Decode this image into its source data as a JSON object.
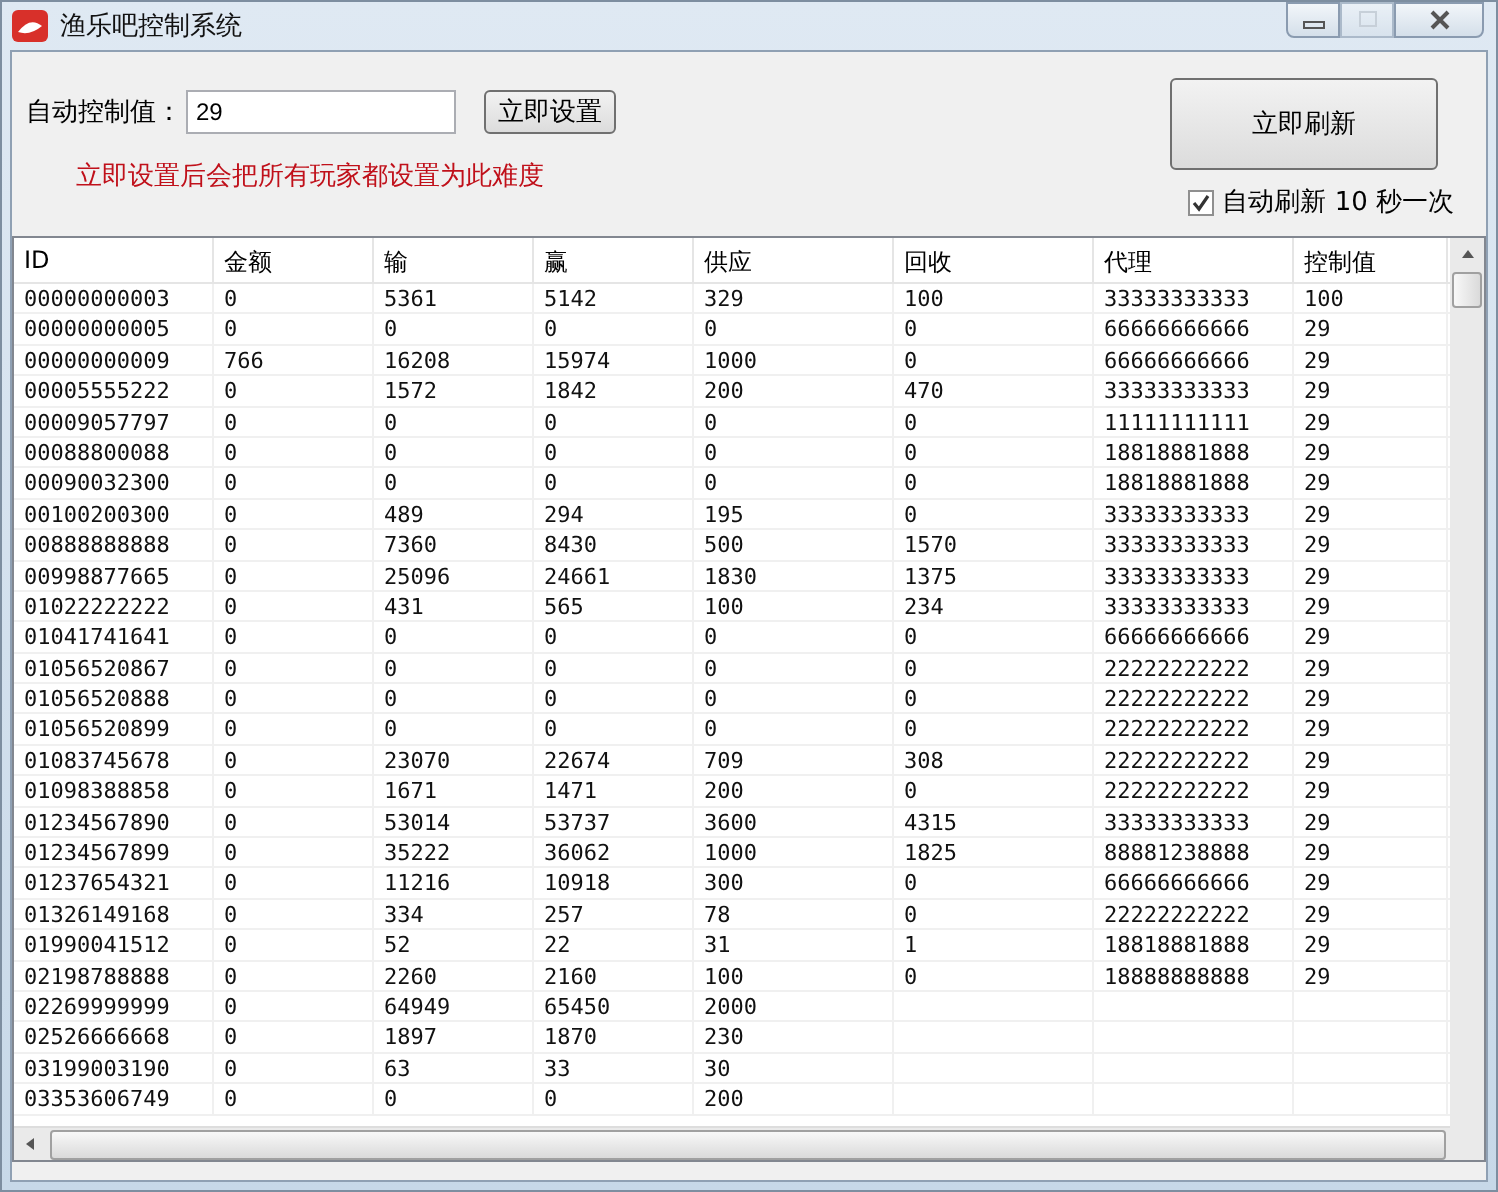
{
  "window": {
    "title": "渔乐吧控制系统",
    "buttons": [
      {
        "kind": "minimize",
        "disabled": false
      },
      {
        "kind": "maximize",
        "disabled": true
      },
      {
        "kind": "close",
        "disabled": false
      }
    ]
  },
  "controls": {
    "label": "自动控制值：",
    "value": "29",
    "set_button": "立即设置",
    "warning": "立即设置后会把所有玩家都设置为此难度",
    "refresh_button": "立即刷新",
    "auto_refresh": {
      "checked": true,
      "label": "自动刷新 10 秒一次"
    }
  },
  "table": {
    "columns": [
      "ID",
      "金额",
      "输",
      "赢",
      "供应",
      "回收",
      "代理",
      "控制值"
    ],
    "rows": [
      [
        "00000000003",
        "0",
        "5361",
        "5142",
        "329",
        "100",
        "33333333333",
        "100"
      ],
      [
        "00000000005",
        "0",
        "0",
        "0",
        "0",
        "0",
        "66666666666",
        "29"
      ],
      [
        "00000000009",
        "766",
        "16208",
        "15974",
        "1000",
        "0",
        "66666666666",
        "29"
      ],
      [
        "00005555222",
        "0",
        "1572",
        "1842",
        "200",
        "470",
        "33333333333",
        "29"
      ],
      [
        "00009057797",
        "0",
        "0",
        "0",
        "0",
        "0",
        "11111111111",
        "29"
      ],
      [
        "00088800088",
        "0",
        "0",
        "0",
        "0",
        "0",
        "18818881888",
        "29"
      ],
      [
        "00090032300",
        "0",
        "0",
        "0",
        "0",
        "0",
        "18818881888",
        "29"
      ],
      [
        "00100200300",
        "0",
        "489",
        "294",
        "195",
        "0",
        "33333333333",
        "29"
      ],
      [
        "00888888888",
        "0",
        "7360",
        "8430",
        "500",
        "1570",
        "33333333333",
        "29"
      ],
      [
        "00998877665",
        "0",
        "25096",
        "24661",
        "1830",
        "1375",
        "33333333333",
        "29"
      ],
      [
        "01022222222",
        "0",
        "431",
        "565",
        "100",
        "234",
        "33333333333",
        "29"
      ],
      [
        "01041741641",
        "0",
        "0",
        "0",
        "0",
        "0",
        "66666666666",
        "29"
      ],
      [
        "01056520867",
        "0",
        "0",
        "0",
        "0",
        "0",
        "22222222222",
        "29"
      ],
      [
        "01056520888",
        "0",
        "0",
        "0",
        "0",
        "0",
        "22222222222",
        "29"
      ],
      [
        "01056520899",
        "0",
        "0",
        "0",
        "0",
        "0",
        "22222222222",
        "29"
      ],
      [
        "01083745678",
        "0",
        "23070",
        "22674",
        "709",
        "308",
        "22222222222",
        "29"
      ],
      [
        "01098388858",
        "0",
        "1671",
        "1471",
        "200",
        "0",
        "22222222222",
        "29"
      ],
      [
        "01234567890",
        "0",
        "53014",
        "53737",
        "3600",
        "4315",
        "33333333333",
        "29"
      ],
      [
        "01234567899",
        "0",
        "35222",
        "36062",
        "1000",
        "1825",
        "88881238888",
        "29"
      ],
      [
        "01237654321",
        "0",
        "11216",
        "10918",
        "300",
        "0",
        "66666666666",
        "29"
      ],
      [
        "01326149168",
        "0",
        "334",
        "257",
        "78",
        "0",
        "22222222222",
        "29"
      ],
      [
        "01990041512",
        "0",
        "52",
        "22",
        "31",
        "1",
        "18818881888",
        "29"
      ],
      [
        "02198788888",
        "0",
        "2260",
        "2160",
        "100",
        "0",
        "18888888888",
        "29"
      ],
      [
        "02269999999",
        "0",
        "64949",
        "65450",
        "2000"
      ],
      [
        "02526666668",
        "0",
        "1897",
        "1870",
        "230"
      ],
      [
        "03199003190",
        "0",
        "63",
        "33",
        "30"
      ],
      [
        "03353606749",
        "0",
        "0",
        "0",
        "200"
      ]
    ]
  }
}
